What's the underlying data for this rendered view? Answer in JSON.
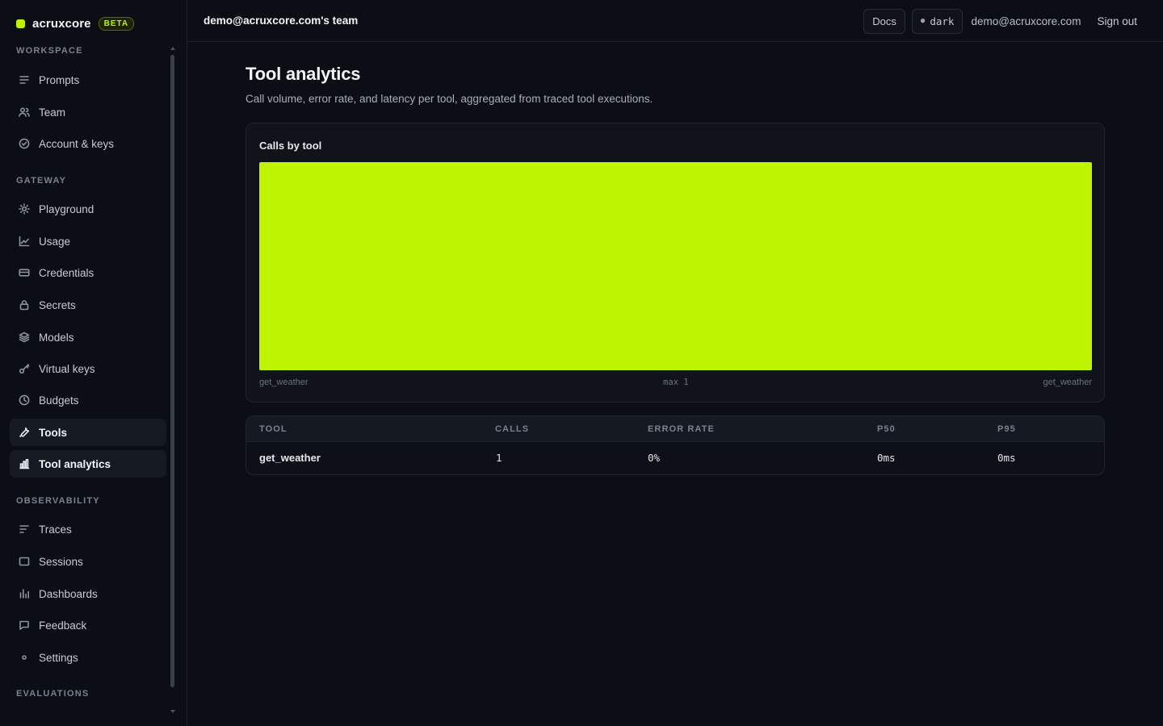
{
  "brand": {
    "name": "acruxcore",
    "badge": "BETA",
    "accent": "#bef400"
  },
  "topbar": {
    "team": "demo@acruxcore.com's team",
    "docs_label": "Docs",
    "theme_label": "dark",
    "user_email": "demo@acruxcore.com",
    "signout_label": "Sign out"
  },
  "sidebar": {
    "sections": [
      {
        "label": "WORKSPACE",
        "items": [
          {
            "label": "Prompts",
            "icon": "list-icon"
          },
          {
            "label": "Team",
            "icon": "users-icon"
          },
          {
            "label": "Account & keys",
            "icon": "check-circle-icon"
          }
        ]
      },
      {
        "label": "GATEWAY",
        "items": [
          {
            "label": "Playground",
            "icon": "sun-icon"
          },
          {
            "label": "Usage",
            "icon": "line-chart-icon"
          },
          {
            "label": "Credentials",
            "icon": "card-icon"
          },
          {
            "label": "Secrets",
            "icon": "lock-icon"
          },
          {
            "label": "Models",
            "icon": "layers-icon"
          },
          {
            "label": "Virtual keys",
            "icon": "key-icon"
          },
          {
            "label": "Budgets",
            "icon": "clock-icon"
          },
          {
            "label": "Tools",
            "icon": "wrench-icon"
          },
          {
            "label": "Tool analytics",
            "icon": "bar-chart-icon",
            "active": true
          }
        ]
      },
      {
        "label": "OBSERVABILITY",
        "items": [
          {
            "label": "Traces",
            "icon": "traces-icon"
          },
          {
            "label": "Sessions",
            "icon": "window-icon"
          },
          {
            "label": "Dashboards",
            "icon": "dashboard-icon"
          },
          {
            "label": "Feedback",
            "icon": "message-icon"
          },
          {
            "label": "Settings",
            "icon": "dot-icon"
          }
        ]
      },
      {
        "label": "EVALUATIONS",
        "items": []
      }
    ]
  },
  "main": {
    "title": "Tool analytics",
    "subtitle": "Call volume, error rate, and latency per tool, aggregated from traced tool executions."
  },
  "chart_data": {
    "type": "bar",
    "title": "Calls by tool",
    "categories": [
      "get_weather"
    ],
    "values": [
      1
    ],
    "ylim": [
      0,
      1
    ],
    "color": "#bef400",
    "axis_start_label": "get_weather",
    "axis_mid_label": "max 1",
    "axis_end_label": "get_weather"
  },
  "table": {
    "columns": [
      "TOOL",
      "CALLS",
      "ERROR RATE",
      "P50",
      "P95"
    ],
    "rows": [
      {
        "tool": "get_weather",
        "calls": "1",
        "error_rate": "0%",
        "p50": "0ms",
        "p95": "0ms"
      }
    ]
  }
}
